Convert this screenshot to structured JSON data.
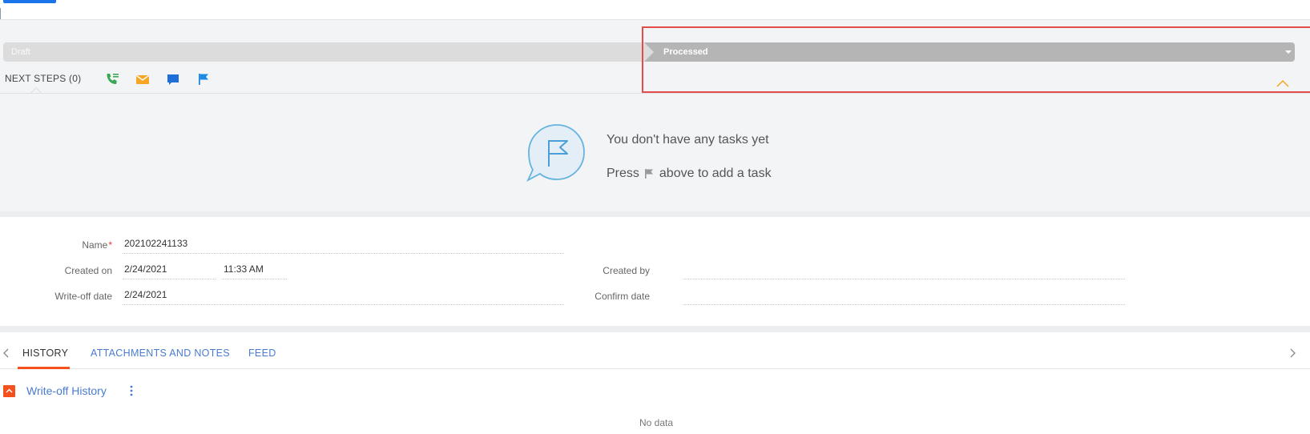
{
  "stages": {
    "draft_label": "Draft",
    "processed_label": "Processed"
  },
  "next_steps": {
    "label": "NEXT STEPS (0)",
    "actions": [
      "call-icon",
      "email-icon",
      "chat-icon",
      "flag-icon"
    ]
  },
  "empty_state": {
    "title": "You don't have any tasks yet",
    "hint_before": "Press",
    "hint_after": "above to add a task"
  },
  "form": {
    "name_label": "Name",
    "name_value": "202102241133",
    "created_on_label": "Created on",
    "created_on_date": "2/24/2021",
    "created_on_time": "11:33 AM",
    "writeoff_label": "Write-off date",
    "writeoff_value": "2/24/2021",
    "created_by_label": "Created by",
    "created_by_value": "",
    "confirm_label": "Confirm date",
    "confirm_value": ""
  },
  "tabs": [
    {
      "label": "HISTORY"
    },
    {
      "label": "ATTACHMENTS AND NOTES"
    },
    {
      "label": "FEED"
    }
  ],
  "detail": {
    "title": "Write-off History",
    "empty": "No data"
  },
  "colors": {
    "accent_orange": "#f4511e",
    "link_blue": "#4a7bd0",
    "highlight_red": "#e44b4b",
    "stage_done": "#dcdcdc",
    "stage_current": "#b5b5b5"
  }
}
